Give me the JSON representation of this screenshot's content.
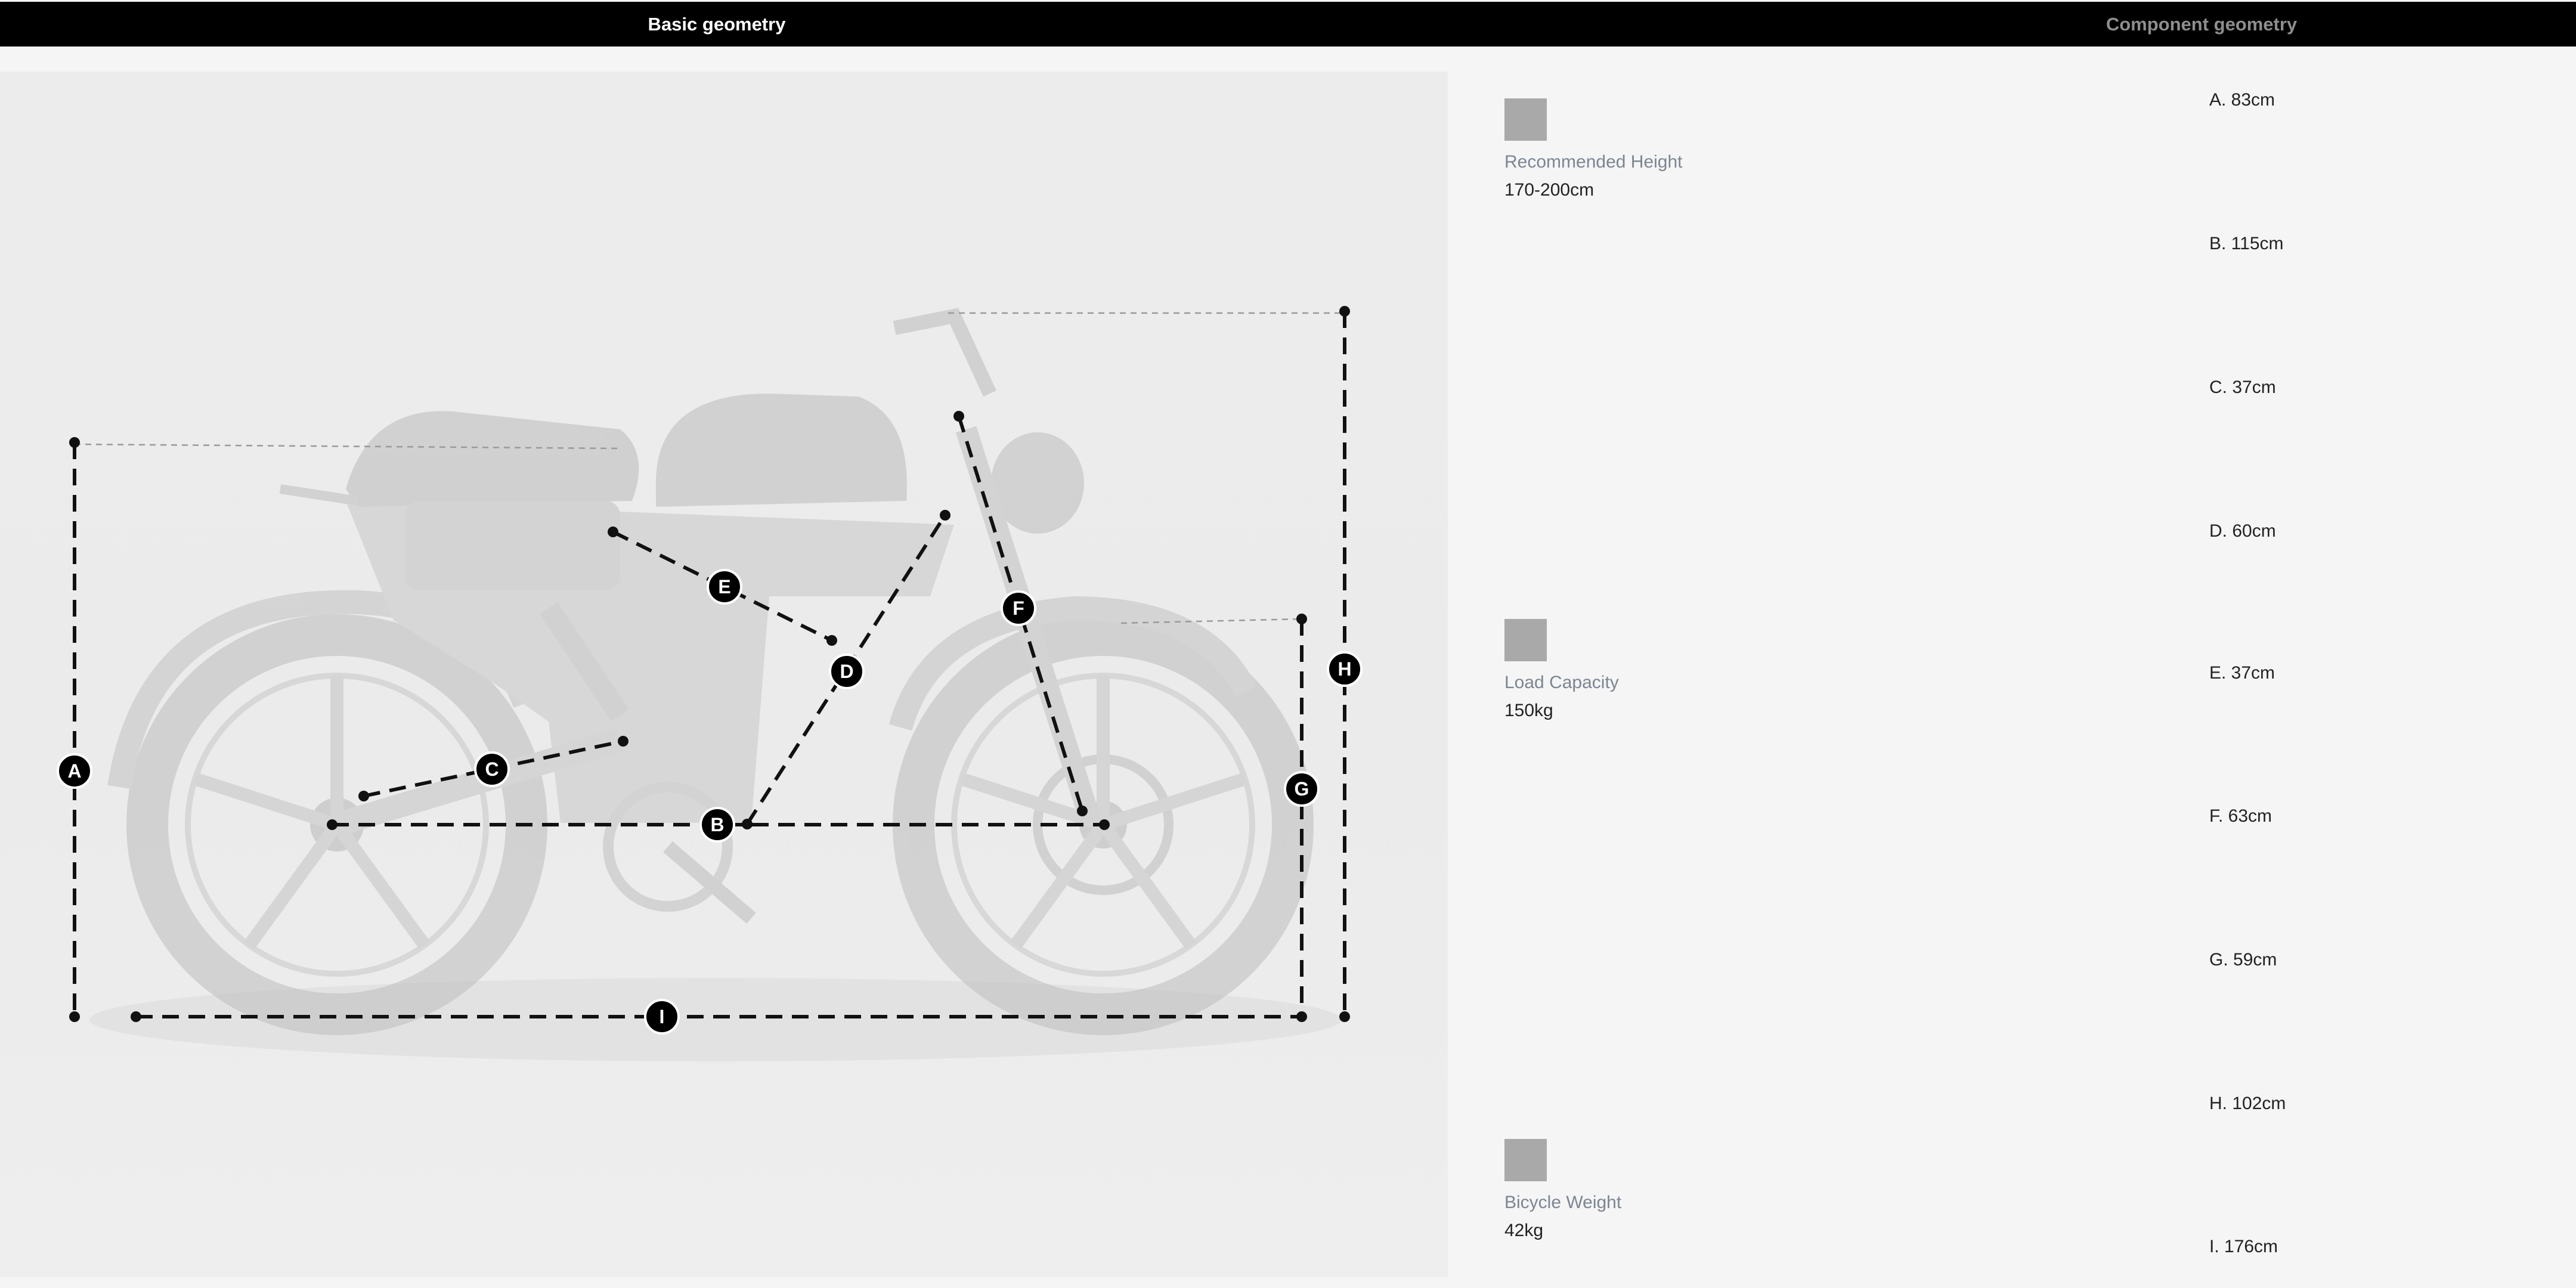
{
  "tabs": {
    "basic": "Basic geometry",
    "component": "Component geometry"
  },
  "specs": {
    "height_label": "Recommended Height",
    "height_value": "170-200cm",
    "load_label": "Load Capacity",
    "load_value": "150kg",
    "weight_label": "Bicycle Weight",
    "weight_value": "42kg"
  },
  "geometry": [
    "A. 83cm",
    "B. 115cm",
    "C. 37cm",
    "D. 60cm",
    "E. 37cm",
    "F. 63cm",
    "G. 59cm",
    "H. 102cm",
    "I. 176cm"
  ],
  "markers": {
    "a": "A",
    "b": "B",
    "c": "C",
    "d": "D",
    "e": "E",
    "f": "F",
    "g": "G",
    "h": "H",
    "i": "I"
  }
}
